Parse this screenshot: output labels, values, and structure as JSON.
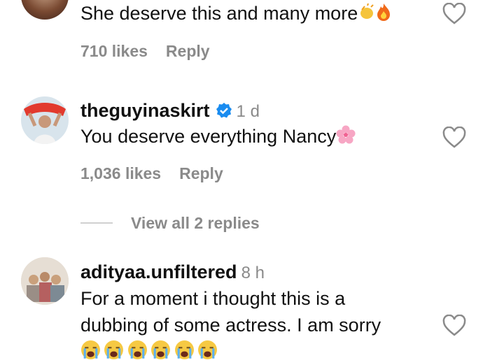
{
  "comments": [
    {
      "text": "She deserve this and many more",
      "emojis": [
        "clapping-hands",
        "fire"
      ],
      "likes": "710 likes",
      "reply": "Reply"
    },
    {
      "username": "theguyinaskirt",
      "verified": true,
      "time": "1 d",
      "text": "You deserve everything Nancy",
      "emojis": [
        "cherry-blossom"
      ],
      "likes": "1,036 likes",
      "reply": "Reply",
      "view_replies": "View all 2 replies"
    },
    {
      "username": "adityaa.unfiltered",
      "time": "8 h",
      "text_line1": "For a moment i thought this is a",
      "text_line2": "dubbing of some actress. I am sorry",
      "emojis": [
        "loudly-crying-face",
        "loudly-crying-face",
        "loudly-crying-face",
        "loudly-crying-face",
        "loudly-crying-face",
        "loudly-crying-face"
      ]
    }
  ],
  "colors": {
    "verified": "#1a8cf0",
    "meta": "#8a8a8a",
    "heart_stroke": "#8a8a8a"
  }
}
